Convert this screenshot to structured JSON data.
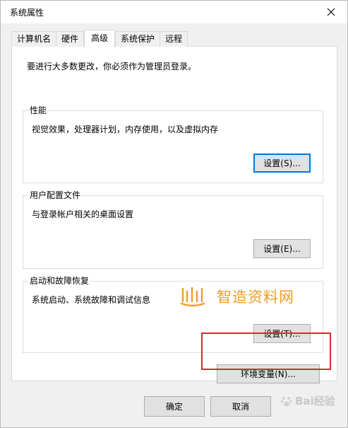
{
  "window": {
    "title": "系统属性"
  },
  "tabs": [
    {
      "label": "计算机名",
      "active": false
    },
    {
      "label": "硬件",
      "active": false
    },
    {
      "label": "高级",
      "active": true
    },
    {
      "label": "系统保护",
      "active": false
    },
    {
      "label": "远程",
      "active": false
    }
  ],
  "notice": "要进行大多数更改，你必须作为管理员登录。",
  "groups": {
    "performance": {
      "title": "性能",
      "description": "视觉效果，处理器计划，内存使用，以及虚拟内存",
      "button": "设置(S)..."
    },
    "profiles": {
      "title": "用户配置文件",
      "description": "与登录帐户相关的桌面设置",
      "button": "设置(E)..."
    },
    "startup": {
      "title": "启动和故障恢复",
      "description": "系统启动、系统故障和调试信息",
      "button": "设置(T)..."
    }
  },
  "env_button": "环境变量(N)...",
  "footer": {
    "ok": "确定",
    "cancel": "取消"
  },
  "watermarks": {
    "site": "智造资料网",
    "baidu": "Bai经验"
  },
  "colors": {
    "highlight": "#d42c2c",
    "watermark": "#f09a2a",
    "focus": "#0078d7"
  }
}
